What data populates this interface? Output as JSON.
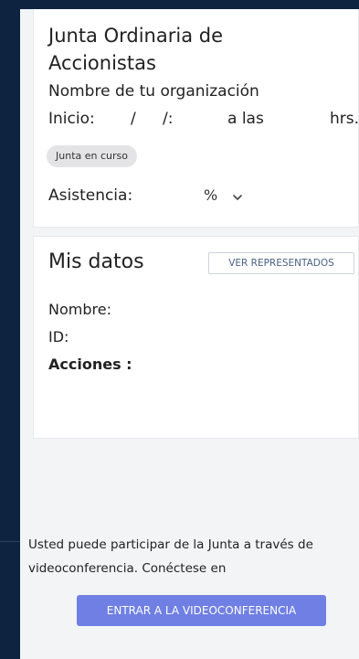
{
  "junta": {
    "title": "Junta Ordinaria de Accionistas",
    "organization": "Nombre de tu organización",
    "inicio_label": "Inicio:",
    "date_sep_1": "/",
    "date_sep_2": "/:",
    "a_las": "a las",
    "hrs": "hrs.",
    "status_badge": "Junta en curso",
    "asistencia_label": "Asistencia:",
    "percent_sign": "%"
  },
  "mis_datos": {
    "title": "Mis datos",
    "ver_representados": "VER REPRESENTADOS",
    "nombre_label": "Nombre:",
    "id_label": "ID:",
    "acciones_label": "Acciones :"
  },
  "videoconference": {
    "note": "Usted puede participar de la Junta a través de videoconferencia. Conéctese en",
    "button_label": "ENTRAR A LA VIDEOCONFERENCIA"
  },
  "colors": {
    "background": "#0d2340",
    "panel": "#f3f4f6",
    "accent_button": "#6f7fe3",
    "outline_button_text": "#4a6185"
  },
  "icons": {
    "asistencia_toggle": "chevron-down-icon"
  }
}
